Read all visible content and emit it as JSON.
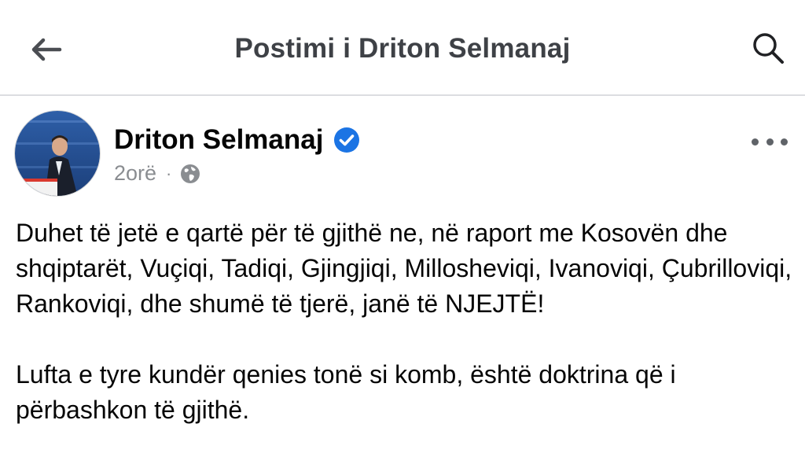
{
  "header": {
    "title": "Postimi i Driton Selmanaj",
    "back_icon": "arrow-left-icon",
    "search_icon": "search-icon"
  },
  "post": {
    "author_name": "Driton Selmanaj",
    "verified": true,
    "time": "2orë",
    "separator": "·",
    "privacy_icon": "globe-icon",
    "more_icon": "more-options-icon",
    "paragraphs": [
      "Duhet të jetë e qartë për të gjithë ne, në raport me Kosovën dhe shqiptarët, Vuçiqi, Tadiqi, Gjingjiqi, Milloshevi­qi, Ivanoviqi, Çubrilloviqi, Rankoviqi, dhe shumë të tjerë, janë të NJEJTË!",
      "Lufta e tyre kundër qenies tonë si komb, është doktrina që i përbashkon të gjithë."
    ]
  },
  "colors": {
    "verified_blue": "#1b74e4",
    "meta_gray": "#8a8d91",
    "title_gray": "#3e4146"
  }
}
